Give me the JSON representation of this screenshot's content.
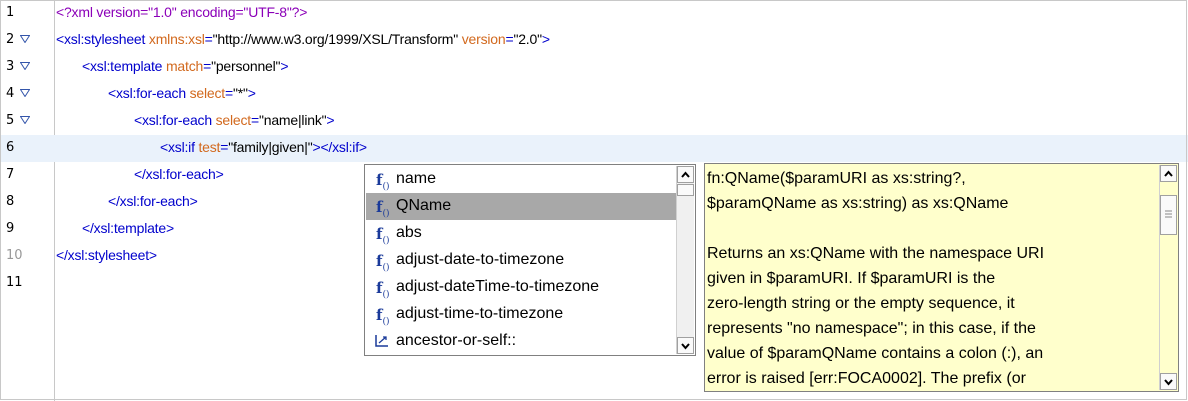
{
  "lines": [
    {
      "num": "1",
      "dim": false,
      "fold": false,
      "indent": 0,
      "tokens": [
        {
          "t": "pi",
          "v": "<?xml version=\"1.0\" encoding=\"UTF-8\"?>"
        }
      ]
    },
    {
      "num": "2",
      "dim": false,
      "fold": true,
      "indent": 0,
      "tokens": [
        {
          "t": "tag",
          "v": "<xsl:stylesheet "
        },
        {
          "t": "attr",
          "v": "xmlns:xsl"
        },
        {
          "t": "tag",
          "v": "="
        },
        {
          "t": "str",
          "v": "\"http://www.w3.org/1999/XSL/Transform\""
        },
        {
          "t": "attr",
          "v": " version"
        },
        {
          "t": "tag",
          "v": "="
        },
        {
          "t": "str",
          "v": "\"2.0\""
        },
        {
          "t": "tag",
          "v": ">"
        }
      ]
    },
    {
      "num": "3",
      "dim": false,
      "fold": true,
      "indent": 1,
      "tokens": [
        {
          "t": "tag",
          "v": "<xsl:template "
        },
        {
          "t": "attr",
          "v": "match"
        },
        {
          "t": "tag",
          "v": "="
        },
        {
          "t": "str",
          "v": "\"personnel\""
        },
        {
          "t": "tag",
          "v": ">"
        }
      ]
    },
    {
      "num": "4",
      "dim": false,
      "fold": true,
      "indent": 2,
      "tokens": [
        {
          "t": "tag",
          "v": "<xsl:for-each "
        },
        {
          "t": "attr",
          "v": "select"
        },
        {
          "t": "tag",
          "v": "="
        },
        {
          "t": "str",
          "v": "\"*\""
        },
        {
          "t": "tag",
          "v": ">"
        }
      ]
    },
    {
      "num": "5",
      "dim": false,
      "fold": true,
      "indent": 3,
      "tokens": [
        {
          "t": "tag",
          "v": "<xsl:for-each "
        },
        {
          "t": "attr",
          "v": "select"
        },
        {
          "t": "tag",
          "v": "="
        },
        {
          "t": "str",
          "v": "\"name|link\""
        },
        {
          "t": "tag",
          "v": ">"
        }
      ]
    },
    {
      "num": "6",
      "dim": false,
      "fold": false,
      "indent": 4,
      "current": true,
      "tokens": [
        {
          "t": "tag",
          "v": "<xsl:if "
        },
        {
          "t": "attr",
          "v": "test"
        },
        {
          "t": "tag",
          "v": "="
        },
        {
          "t": "str",
          "v": "\"family|given|\""
        },
        {
          "t": "tag",
          "v": "></xsl:if>"
        }
      ]
    },
    {
      "num": "7",
      "dim": false,
      "fold": false,
      "indent": 3,
      "tokens": [
        {
          "t": "tag",
          "v": "</xsl:for-each>"
        }
      ]
    },
    {
      "num": "8",
      "dim": false,
      "fold": false,
      "indent": 2,
      "tokens": [
        {
          "t": "tag",
          "v": "</xsl:for-each>"
        }
      ]
    },
    {
      "num": "9",
      "dim": false,
      "fold": false,
      "indent": 1,
      "tokens": [
        {
          "t": "tag",
          "v": "</xsl:template>"
        }
      ]
    },
    {
      "num": "10",
      "dim": true,
      "fold": false,
      "indent": 0,
      "tokens": [
        {
          "t": "tag",
          "v": "</xsl:stylesheet>"
        }
      ]
    },
    {
      "num": "11",
      "dim": false,
      "fold": false,
      "indent": 0,
      "tokens": []
    }
  ],
  "completion": {
    "items": [
      {
        "icon": "function-icon",
        "label": "name",
        "selected": false
      },
      {
        "icon": "function-icon",
        "label": "QName",
        "selected": true
      },
      {
        "icon": "function-icon",
        "label": "abs",
        "selected": false
      },
      {
        "icon": "function-icon",
        "label": "adjust-date-to-timezone",
        "selected": false
      },
      {
        "icon": "function-icon",
        "label": "adjust-dateTime-to-timezone",
        "selected": false
      },
      {
        "icon": "function-icon",
        "label": "adjust-time-to-timezone",
        "selected": false
      },
      {
        "icon": "axis-icon",
        "label": "ancestor-or-self::",
        "selected": false
      }
    ]
  },
  "doc": {
    "text": "fn:QName($paramURI as xs:string?,\n$paramQName as xs:string) as xs:QName\n\nReturns an xs:QName with the namespace URI\ngiven in $paramURI. If $paramURI is the\nzero-length string or the empty sequence, it\nrepresents \"no namespace\"; in this case, if the\nvalue of $paramQName contains a colon (:), an\nerror is raised [err:FOCA0002]. The prefix (or"
  },
  "colors": {
    "tag": "#0000cc",
    "attr": "#d2691e",
    "string": "#000000",
    "pi": "#8b00b8",
    "selection": "#a8a8a8",
    "tooltip": "#ffffcc"
  }
}
